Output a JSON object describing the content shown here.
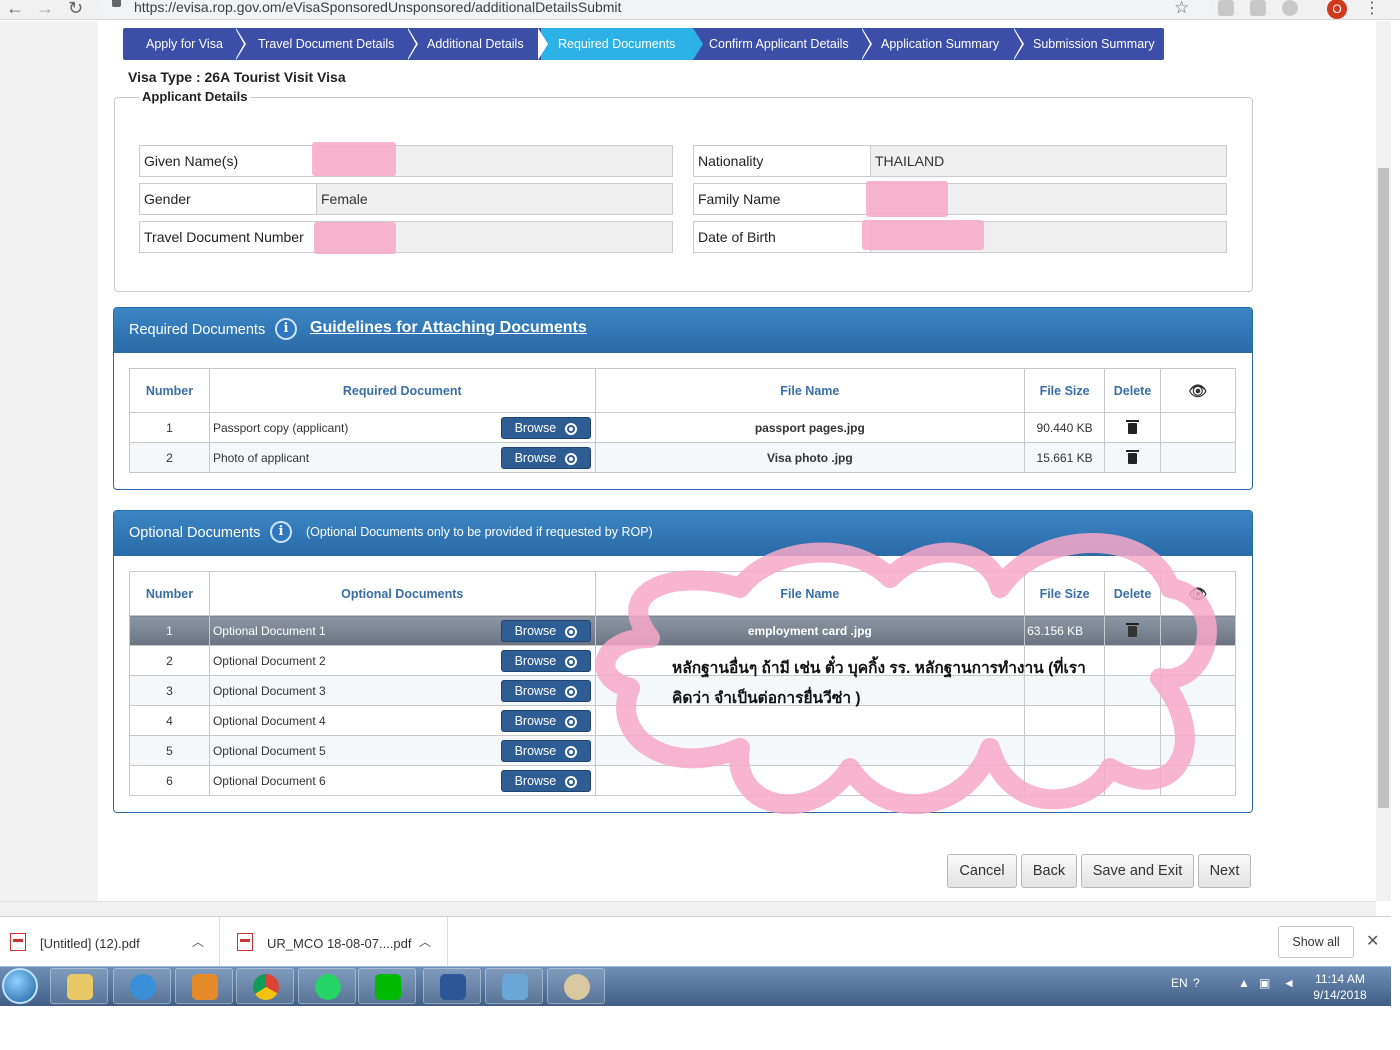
{
  "browser": {
    "url": "https://evisa.rop.gov.om/eVisaSponsoredUnsponsored/additionalDetailsSubmit",
    "profile_initial": "O"
  },
  "steps": [
    {
      "label": "Apply for Visa"
    },
    {
      "label": "Travel Document Details"
    },
    {
      "label": "Additional Details"
    },
    {
      "label": "Required Documents"
    },
    {
      "label": "Confirm Applicant Details"
    },
    {
      "label": "Application Summary"
    },
    {
      "label": "Submission Summary"
    }
  ],
  "visa_type": "Visa Type  : 26A Tourist Visit Visa",
  "applicant": {
    "legend": "Applicant Details",
    "given_name_label": "Given Name(s)",
    "given_name_value": "",
    "gender_label": "Gender",
    "gender_value": "Female",
    "travel_doc_label": "Travel Document Number",
    "travel_doc_value": "",
    "nationality_label": "Nationality",
    "nationality_value": "THAILAND",
    "family_name_label": "Family Name",
    "family_name_value": "",
    "dob_label": "Date of Birth",
    "dob_value": ""
  },
  "required_panel": {
    "title": "Required Documents",
    "guidelines_link": "Guidelines for Attaching Documents",
    "columns": [
      "Number",
      "Required Document",
      "File Name",
      "File Size",
      "Delete"
    ],
    "rows": [
      {
        "number": "1",
        "document": "Passport copy (applicant)",
        "file_name": "passport pages.jpg",
        "file_size": "90.440 KB"
      },
      {
        "number": "2",
        "document": "Photo of applicant",
        "file_name": "Visa photo .jpg",
        "file_size": "15.661 KB"
      }
    ]
  },
  "optional_panel": {
    "title": "Optional Documents",
    "note": "(Optional Documents only to be provided if requested by ROP)",
    "columns": [
      "Number",
      "Optional Documents",
      "File Name",
      "File Size",
      "Delete"
    ],
    "rows": [
      {
        "number": "1",
        "document": "Optional Document 1",
        "file_name": "employment card .jpg",
        "file_size": "63.156 KB"
      },
      {
        "number": "2",
        "document": "Optional Document 2",
        "file_name": "",
        "file_size": ""
      },
      {
        "number": "3",
        "document": "Optional Document 3",
        "file_name": "",
        "file_size": ""
      },
      {
        "number": "4",
        "document": "Optional Document 4",
        "file_name": "",
        "file_size": ""
      },
      {
        "number": "5",
        "document": "Optional Document 5",
        "file_name": "",
        "file_size": ""
      },
      {
        "number": "6",
        "document": "Optional Document 6",
        "file_name": "",
        "file_size": ""
      }
    ]
  },
  "browse_label": "Browse",
  "annotation": {
    "line1": "หลักฐานอื่นๆ ถ้ามี เช่น  ตั๋ว  บุคกิ้ง รร. หลักฐานการทำงาน  (ที่เรา",
    "line2": "คิดว่า จำเป็นต่อการยื่นวีซ่า )"
  },
  "actions": {
    "cancel": "Cancel",
    "back": "Back",
    "save_exit": "Save and Exit",
    "next": "Next"
  },
  "downloads": [
    {
      "name": "[Untitled] (12).pdf"
    },
    {
      "name": "UR_MCO 18-08-07....pdf"
    }
  ],
  "downloads_show_all": "Show all",
  "taskbar": {
    "lang": "EN",
    "time": "11:14 AM",
    "date": "9/14/2018"
  },
  "colors": {
    "stepper": "#3c4fa8",
    "active_step": "#2cb2e6",
    "panel_header": "#2a6aa8",
    "browse": "#2d5d93",
    "scribble": "#f7a8c8"
  }
}
